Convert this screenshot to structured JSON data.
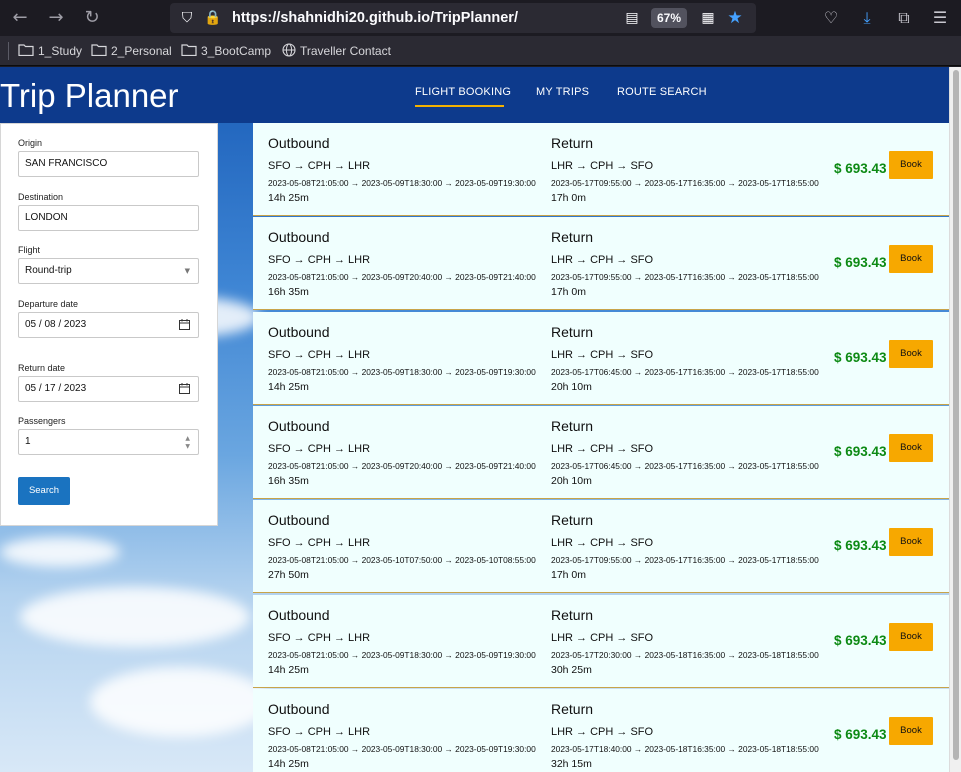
{
  "browser": {
    "url": "https://shahnidhi20.github.io/TripPlanner/",
    "zoom": "67%",
    "bookmarks": [
      "1_Study",
      "2_Personal",
      "3_BootCamp",
      "Traveller Contact"
    ]
  },
  "header": {
    "brand": "Trip Planner",
    "nav": [
      "FLIGHT BOOKING",
      "MY TRIPS",
      "ROUTE SEARCH"
    ],
    "active_nav": "FLIGHT BOOKING",
    "accent_color": "#f3b100"
  },
  "form": {
    "origin_label": "Origin",
    "origin_value": "SAN FRANCISCO",
    "destination_label": "Destination",
    "destination_value": "LONDON",
    "flight_label": "Flight",
    "flight_value": "Round-trip",
    "departure_label": "Departure date",
    "departure_value": "05 / 08 / 2023",
    "return_label": "Return date",
    "return_value": "05 / 17 / 2023",
    "passengers_label": "Passengers",
    "passengers_value": "1",
    "search_label": "Search"
  },
  "results": {
    "outbound_heading": "Outbound",
    "return_heading": "Return",
    "book_label": "Book",
    "price_color": "#0d8a14",
    "items": [
      {
        "out_route": "SFO → CPH → LHR",
        "out_times": "2023-05-08T21:05:00 → 2023-05-09T18:30:00 → 2023-05-09T19:30:00",
        "out_dur": "14h 25m",
        "ret_route": "LHR → CPH → SFO",
        "ret_times": "2023-05-17T09:55:00 → 2023-05-17T16:35:00 → 2023-05-17T18:55:00",
        "ret_dur": "17h 0m",
        "price": "$ 693.43"
      },
      {
        "out_route": "SFO → CPH → LHR",
        "out_times": "2023-05-08T21:05:00 → 2023-05-09T20:40:00 → 2023-05-09T21:40:00",
        "out_dur": "16h 35m",
        "ret_route": "LHR → CPH → SFO",
        "ret_times": "2023-05-17T09:55:00 → 2023-05-17T16:35:00 → 2023-05-17T18:55:00",
        "ret_dur": "17h 0m",
        "price": "$ 693.43"
      },
      {
        "out_route": "SFO → CPH → LHR",
        "out_times": "2023-05-08T21:05:00 → 2023-05-09T18:30:00 → 2023-05-09T19:30:00",
        "out_dur": "14h 25m",
        "ret_route": "LHR → CPH → SFO",
        "ret_times": "2023-05-17T06:45:00 → 2023-05-17T16:35:00 → 2023-05-17T18:55:00",
        "ret_dur": "20h 10m",
        "price": "$ 693.43"
      },
      {
        "out_route": "SFO → CPH → LHR",
        "out_times": "2023-05-08T21:05:00 → 2023-05-09T20:40:00 → 2023-05-09T21:40:00",
        "out_dur": "16h 35m",
        "ret_route": "LHR → CPH → SFO",
        "ret_times": "2023-05-17T06:45:00 → 2023-05-17T16:35:00 → 2023-05-17T18:55:00",
        "ret_dur": "20h 10m",
        "price": "$ 693.43"
      },
      {
        "out_route": "SFO → CPH → LHR",
        "out_times": "2023-05-08T21:05:00 → 2023-05-10T07:50:00 → 2023-05-10T08:55:00",
        "out_dur": "27h 50m",
        "ret_route": "LHR → CPH → SFO",
        "ret_times": "2023-05-17T09:55:00 → 2023-05-17T16:35:00 → 2023-05-17T18:55:00",
        "ret_dur": "17h 0m",
        "price": "$ 693.43"
      },
      {
        "out_route": "SFO → CPH → LHR",
        "out_times": "2023-05-08T21:05:00 → 2023-05-09T18:30:00 → 2023-05-09T19:30:00",
        "out_dur": "14h 25m",
        "ret_route": "LHR → CPH → SFO",
        "ret_times": "2023-05-17T20:30:00 → 2023-05-18T16:35:00 → 2023-05-18T18:55:00",
        "ret_dur": "30h 25m",
        "price": "$ 693.43"
      },
      {
        "out_route": "SFO → CPH → LHR",
        "out_times": "2023-05-08T21:05:00 → 2023-05-09T18:30:00 → 2023-05-09T19:30:00",
        "out_dur": "14h 25m",
        "ret_route": "LHR → CPH → SFO",
        "ret_times": "2023-05-17T18:40:00 → 2023-05-18T16:35:00 → 2023-05-18T18:55:00",
        "ret_dur": "32h 15m",
        "price": "$ 693.43"
      }
    ]
  }
}
